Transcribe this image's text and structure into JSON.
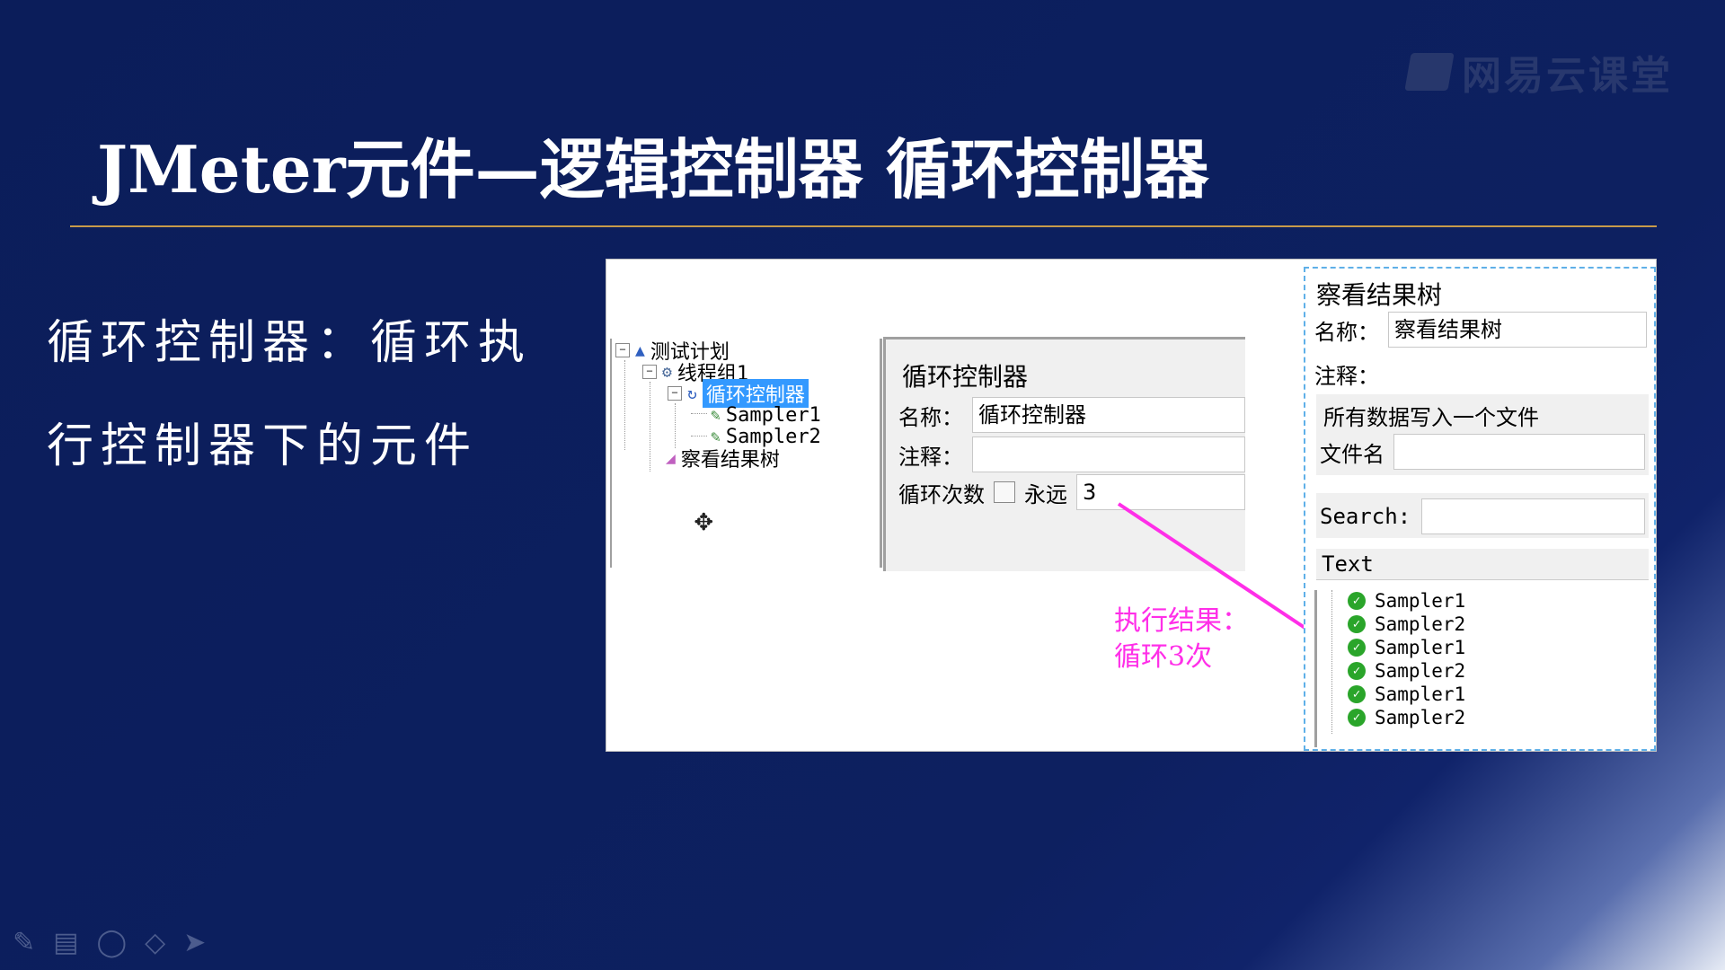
{
  "slide": {
    "title": "JMeter元件—逻辑控制器  循环控制器",
    "brand": "网易云课堂",
    "description_line1": "循环控制器：循环执",
    "description_line2": "行控制器下的元件"
  },
  "tree": {
    "items": [
      {
        "label": "测试计划",
        "icon": "flask-icon"
      },
      {
        "label": "线程组1",
        "icon": "gear-icon"
      },
      {
        "label": "循环控制器",
        "icon": "loop-icon",
        "selected": true
      },
      {
        "label": "Sampler1",
        "icon": "pen-icon"
      },
      {
        "label": "Sampler2",
        "icon": "pen-icon"
      },
      {
        "label": "察看结果树",
        "icon": "chart-icon"
      }
    ]
  },
  "loop_controller": {
    "panel_title": "循环控制器",
    "name_label": "名称：",
    "name_value": "循环控制器",
    "comment_label": "注释：",
    "loop_count_label": "循环次数",
    "forever_label": "永远",
    "loop_count_value": "3"
  },
  "callout": {
    "line1": "执行结果：",
    "line2": "循环3次",
    "color": "#ff2ee8"
  },
  "results_tree": {
    "panel_title": "察看结果树",
    "name_label": "名称：",
    "name_value": "察看结果树",
    "comment_label": "注释：",
    "write_all_label": "所有数据写入一个文件",
    "filename_label": "文件名",
    "search_label": "Search:",
    "column_header": "Text",
    "results": [
      "Sampler1",
      "Sampler2",
      "Sampler1",
      "Sampler2",
      "Sampler1",
      "Sampler2"
    ]
  }
}
